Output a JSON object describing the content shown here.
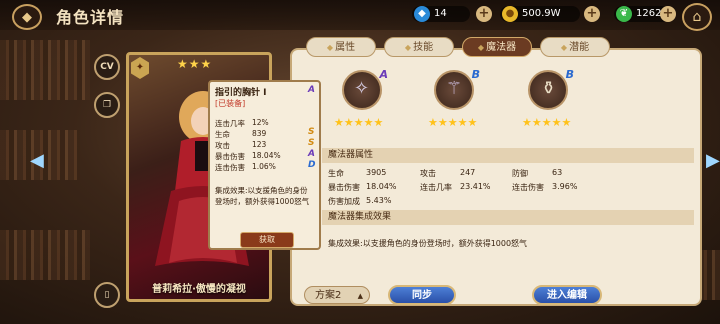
{
  "header": {
    "title": "角色详情",
    "resources": [
      {
        "icon": "blue-gem-icon",
        "value": "14"
      },
      {
        "icon": "gold-coin-icon",
        "value": "500.9W"
      },
      {
        "icon": "green-leaf-icon",
        "value": "1262"
      }
    ]
  },
  "side": {
    "cv_label": "CV"
  },
  "card": {
    "name": "普莉希拉·傲慢的凝视",
    "stars": "★★★"
  },
  "tabs": [
    {
      "label": "属性",
      "active": false
    },
    {
      "label": "技能",
      "active": false
    },
    {
      "label": "魔法器",
      "active": true
    },
    {
      "label": "潜能",
      "active": false
    }
  ],
  "slots": [
    {
      "grade": "A",
      "grade_color": "#6a3ab8",
      "stars": "★★★★★"
    },
    {
      "grade": "B",
      "grade_color": "#2a6ad0",
      "stars": "★★★★★"
    },
    {
      "grade": "B",
      "grade_color": "#2a6ad0",
      "stars": "★★★★★"
    }
  ],
  "attributes": {
    "heading": "魔法器属性",
    "rows": [
      [
        {
          "k": "生命",
          "v": "3905"
        },
        {
          "k": "攻击",
          "v": "247"
        },
        {
          "k": "防御",
          "v": "63"
        }
      ],
      [
        {
          "k": "暴击伤害",
          "v": "18.04%"
        },
        {
          "k": "连击几率",
          "v": "23.41%"
        },
        {
          "k": "连击伤害",
          "v": "3.96%"
        }
      ],
      [
        {
          "k": "伤害加成",
          "v": "5.43%"
        }
      ]
    ]
  },
  "set_effect": {
    "heading": "魔法器集成效果",
    "text": "集成效果:以支援角色的身份登场时，额外获得1000怒气"
  },
  "footer": {
    "plan_label": "方案2",
    "sync_label": "同步",
    "edit_label": "进入编辑"
  },
  "tooltip": {
    "title": "指引的胸针 I",
    "status": "[已装备]",
    "grade": "A",
    "stats": [
      {
        "k": "连击几率",
        "v": "12%",
        "g": ""
      },
      {
        "k": "生命",
        "v": "839",
        "g": "S"
      },
      {
        "k": "攻击",
        "v": "123",
        "g": "S"
      },
      {
        "k": "暴击伤害",
        "v": "18.04%",
        "g": "A"
      },
      {
        "k": "连击伤害",
        "v": "1.06%",
        "g": "D"
      }
    ],
    "effect": "集成效果:以支援角色的身份登场时，额外获得1000怒气",
    "get_label": "获取"
  }
}
